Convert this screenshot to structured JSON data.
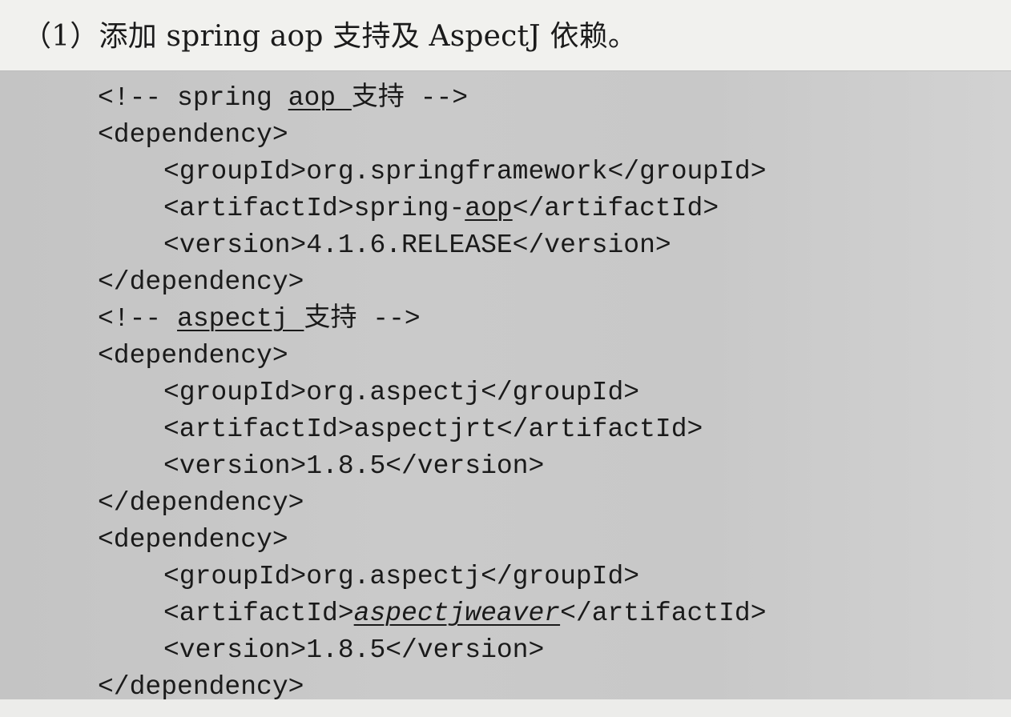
{
  "heading": "（1）添加 spring aop 支持及 AspectJ 依赖。",
  "code": {
    "line1": {
      "a": "<!-- spring ",
      "b": "aop ",
      "c": "支持 -->"
    },
    "line2": "<dependency>",
    "line3": "<groupId>org.springframework</groupId>",
    "line4": {
      "a": "<artifactId>spring-",
      "b": "aop",
      "c": "</artifactId>"
    },
    "line5": "<version>4.1.6.RELEASE</version>",
    "line6": "</dependency>",
    "line7": {
      "a": "<!-- ",
      "b": "aspectj ",
      "c": "支持 -->"
    },
    "line8": "<dependency>",
    "line9": "<groupId>org.aspectj</groupId>",
    "line10": "<artifactId>aspectjrt</artifactId>",
    "line11": "<version>1.8.5</version>",
    "line12": "</dependency>",
    "line13": "<dependency>",
    "line14": "<groupId>org.aspectj</groupId>",
    "line15": {
      "a": "<artifactId>",
      "b": "aspectjweaver",
      "c": "</artifactId>"
    },
    "line16": "<version>1.8.5</version>",
    "line17": "</dependency>"
  }
}
